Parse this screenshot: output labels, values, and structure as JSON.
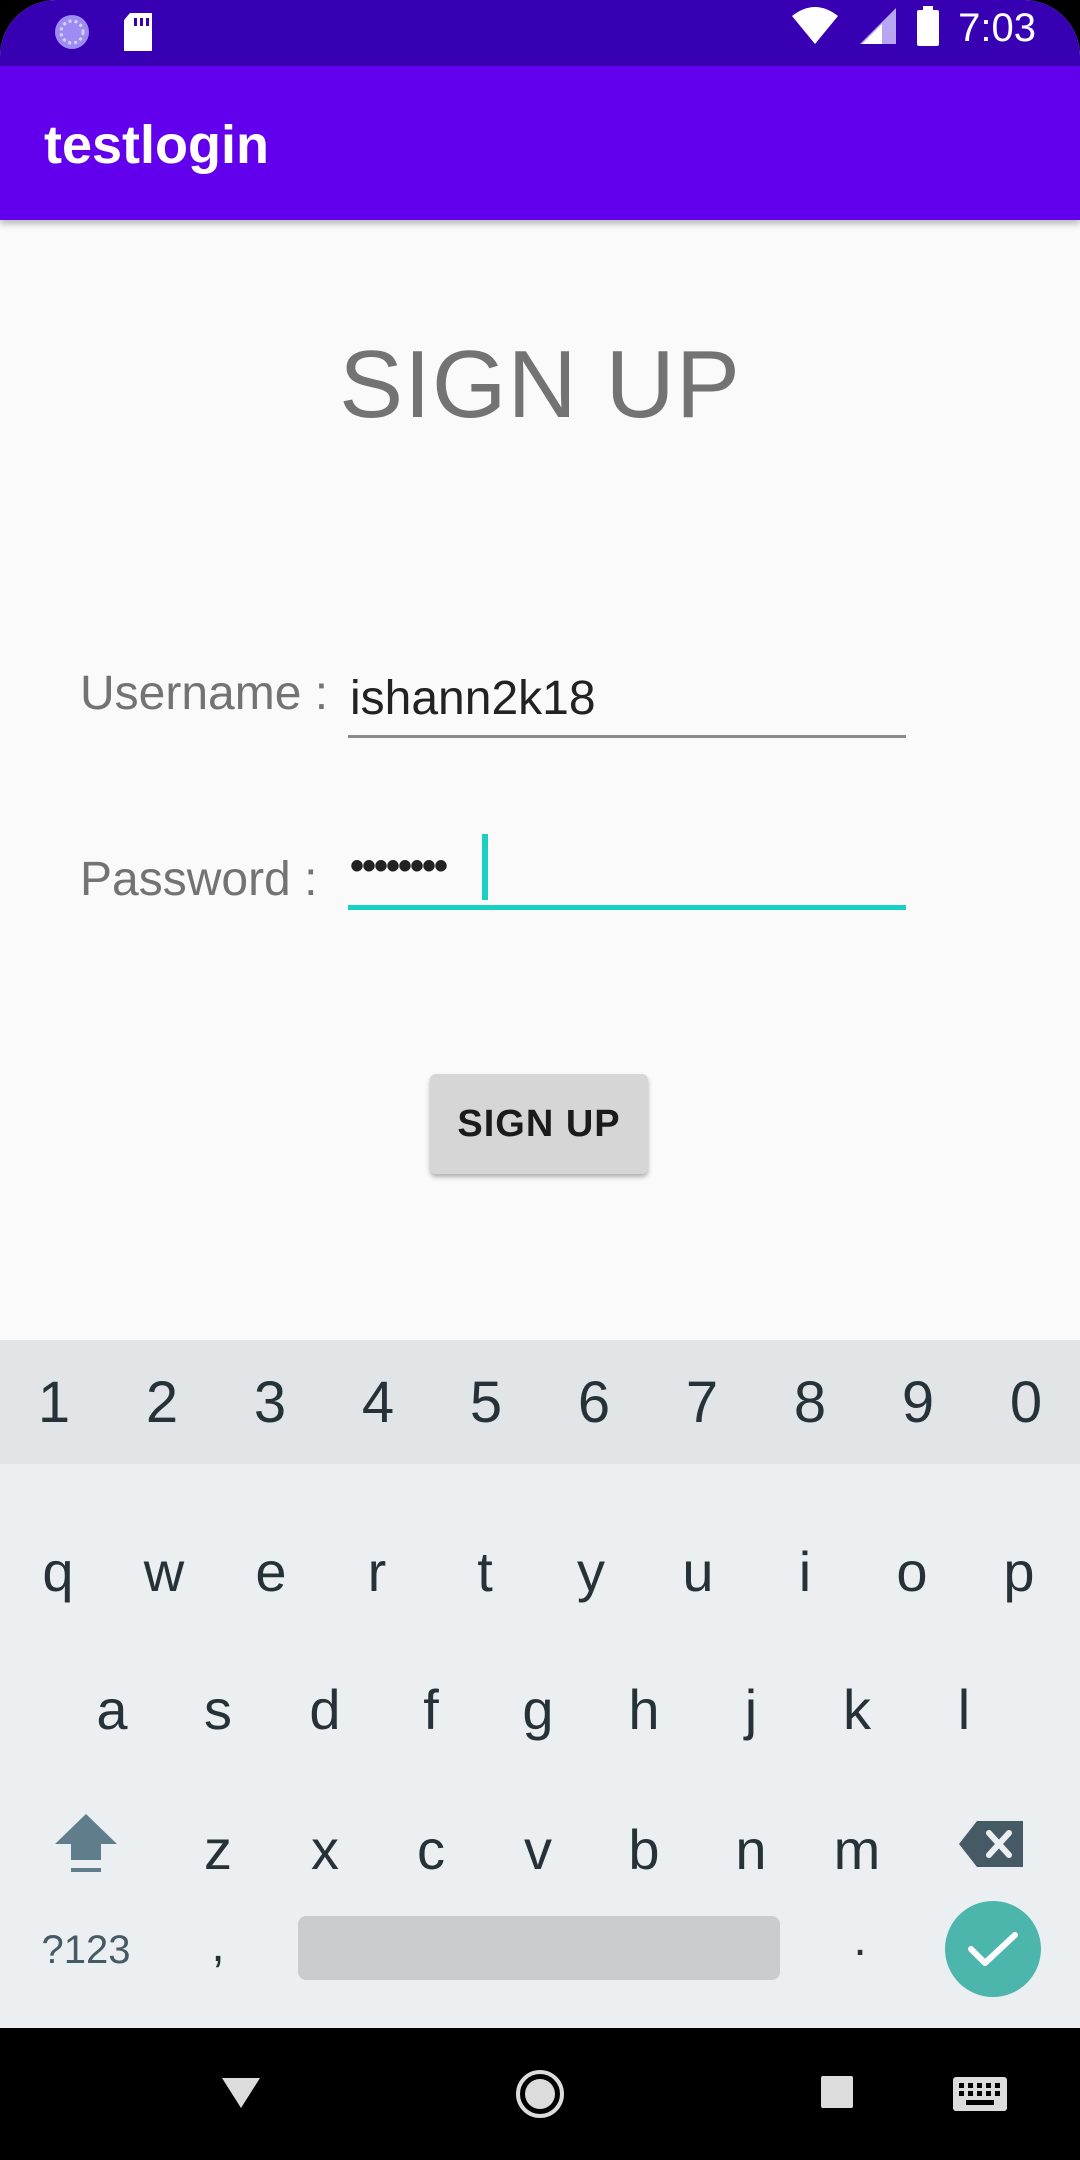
{
  "status_bar": {
    "time": "7:03",
    "left_icons": [
      "sync-icon",
      "sd-card-icon"
    ],
    "right_icons": [
      "wifi-icon",
      "cell-signal-icon",
      "battery-icon"
    ]
  },
  "app_bar": {
    "title": "testlogin"
  },
  "form": {
    "heading": "SIGN UP",
    "username_label": "Username :",
    "username_value": "ishann2k18",
    "password_label": "Password :",
    "password_value": "••••••••",
    "submit_label": "SIGN UP"
  },
  "keyboard": {
    "number_row": [
      "1",
      "2",
      "3",
      "4",
      "5",
      "6",
      "7",
      "8",
      "9",
      "0"
    ],
    "row1": [
      "q",
      "w",
      "e",
      "r",
      "t",
      "y",
      "u",
      "i",
      "o",
      "p"
    ],
    "row2": [
      "a",
      "s",
      "d",
      "f",
      "g",
      "h",
      "j",
      "k",
      "l"
    ],
    "row3": [
      "z",
      "x",
      "c",
      "v",
      "b",
      "n",
      "m"
    ],
    "symbols_key": "?123",
    "comma_key": ",",
    "period_key": ".",
    "accent_color": "#4db6ac"
  },
  "nav_bar": {
    "icons": [
      "back-icon",
      "home-icon",
      "recents-icon",
      "keyboard-switch-icon"
    ]
  }
}
